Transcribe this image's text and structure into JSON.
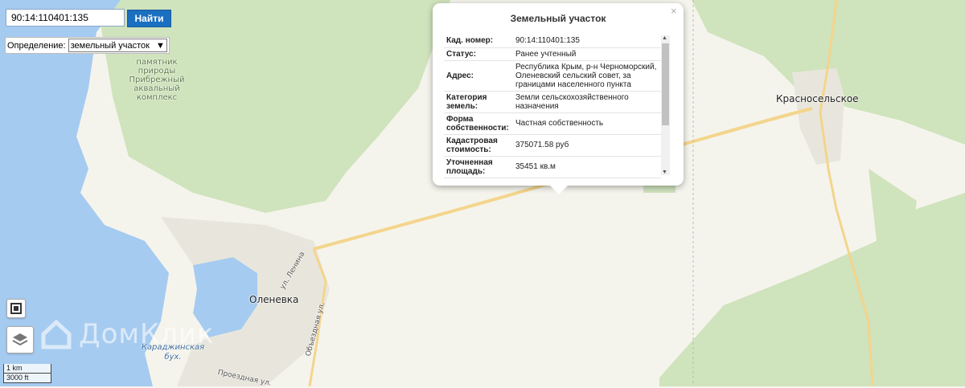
{
  "search": {
    "value": "90:14:110401:135",
    "button": "Найти"
  },
  "definition": {
    "label": "Определение:",
    "selected": "земельный участок"
  },
  "map_labels": {
    "poi": "памятник природы Прибрежный аквальный комплекс",
    "olenevka": "Оленевка",
    "krasnoselskoe": "Красносельское",
    "bay": "Караджинская бух.",
    "street_lenina": "ул. Ленина",
    "street_obezdnaya": "Объездная ул.",
    "street_proezdnaya": "Проездная ул."
  },
  "scale": {
    "km": "1 km",
    "ft": "3000 ft"
  },
  "watermark": "ДомКлик",
  "popup": {
    "title": "Земельный участок",
    "close": "×",
    "rows": [
      {
        "key": "Кад. номер:",
        "value": "90:14:110401:135"
      },
      {
        "key": "Статус:",
        "value": "Ранее учтенный"
      },
      {
        "key": "Адрес:",
        "value": "Республика Крым, р-н Черноморский, Оленевский сельский совет, за границами населенного пункта"
      },
      {
        "key": "Категория земель:",
        "value": "Земли сельскохозяйственного назначения"
      },
      {
        "key": "Форма собственности:",
        "value": "Частная собственность"
      },
      {
        "key": "Кадастровая стоимость:",
        "value": "375071.58 руб"
      },
      {
        "key": "Уточненная площадь:",
        "value": "35451 кв.м"
      }
    ]
  },
  "colors": {
    "water": "#a6cbf0",
    "forest": "#cfe3bd",
    "land": "#f5f4ec",
    "road": "#f3d58c",
    "button": "#1a6fc0"
  }
}
